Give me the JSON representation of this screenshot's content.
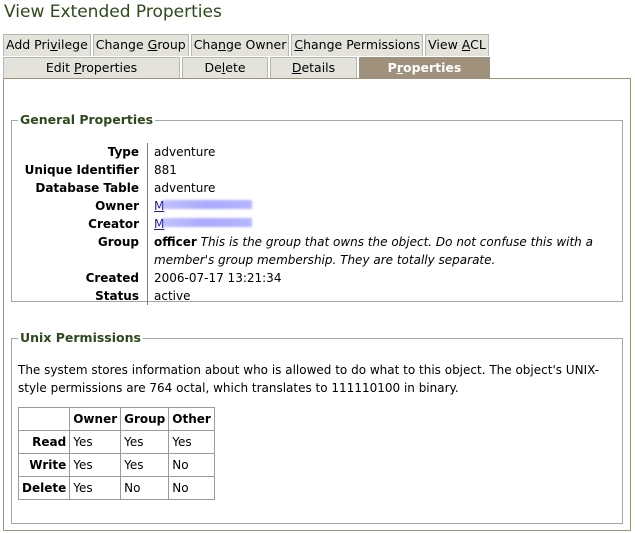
{
  "page": {
    "title": "View Extended Properties"
  },
  "tabs_row1": [
    {
      "pre": "Add Pri",
      "key": "v",
      "post": "ilege"
    },
    {
      "pre": "Change ",
      "key": "G",
      "post": "roup"
    },
    {
      "pre": "Cha",
      "key": "n",
      "post": "ge Owner"
    },
    {
      "pre": "",
      "key": "C",
      "post": "hange Permissions"
    },
    {
      "pre": "View ",
      "key": "A",
      "post": "CL"
    }
  ],
  "tabs_row2": [
    {
      "pre": "Edit ",
      "key": "P",
      "post": "roperties",
      "active": false
    },
    {
      "pre": "De",
      "key": "l",
      "post": "ete",
      "active": false
    },
    {
      "pre": "",
      "key": "D",
      "post": "etails",
      "active": false
    },
    {
      "pre": "P",
      "key": "r",
      "post": "operties",
      "active": true
    }
  ],
  "general": {
    "legend": "General Properties",
    "type_label": "Type",
    "type_value": "adventure",
    "uid_label": "Unique Identifier",
    "uid_value": "881",
    "table_label": "Database Table",
    "table_value": "adventure",
    "owner_label": "Owner",
    "owner_value": "M",
    "creator_label": "Creator",
    "creator_value": "M",
    "group_label": "Group",
    "group_value": "officer",
    "group_note": "This is the group that owns the object. Do not confuse this with a member's group membership. They are totally separate.",
    "created_label": "Created",
    "created_value": "2006-07-17 13:21:34",
    "status_label": "Status",
    "status_value": "active"
  },
  "unix": {
    "legend": "Unix Permissions",
    "description": "The system stores information about who is allowed to do what to this object. The object's UNIX-style permissions are 764 octal, which translates to 111110100 in binary.",
    "columns": [
      "Owner",
      "Group",
      "Other"
    ],
    "rows": [
      {
        "label": "Read",
        "values": [
          "Yes",
          "Yes",
          "Yes"
        ]
      },
      {
        "label": "Write",
        "values": [
          "Yes",
          "Yes",
          "No"
        ]
      },
      {
        "label": "Delete",
        "values": [
          "Yes",
          "No",
          "No"
        ]
      }
    ]
  },
  "colors": {
    "title": "#2c4a1c",
    "active_tab": "#a0917c",
    "tab": "#e3e3dc",
    "link": "#1a1acc"
  }
}
